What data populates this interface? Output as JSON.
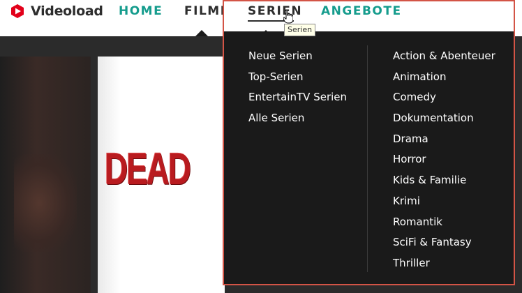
{
  "brand": {
    "name": "Videoload",
    "logo_color": "#e2001a"
  },
  "nav": {
    "items": [
      {
        "label": "HOME",
        "color": "#159c8d"
      },
      {
        "label": "FILME",
        "color": "#2d2d2d"
      },
      {
        "label": "SERIEN",
        "color": "#2d2d2d",
        "active": true
      },
      {
        "label": "ANGEBOTE",
        "color": "#159c8d"
      }
    ]
  },
  "tooltip": "Serien",
  "poster": {
    "title": "DEAD"
  },
  "dropdown": {
    "left_column": [
      "Neue Serien",
      "Top-Serien",
      "EntertainTV Serien",
      "Alle Serien"
    ],
    "right_column": [
      "Action & Abenteuer",
      "Animation",
      "Comedy",
      "Dokumentation",
      "Drama",
      "Horror",
      "Kids & Familie",
      "Krimi",
      "Romantik",
      "SciFi & Fantasy",
      "Thriller"
    ]
  },
  "icons": {
    "logo": "videoload-logo-icon",
    "cursor": "hand-pointer-icon"
  },
  "colors": {
    "accent": "#159c8d",
    "highlight_border": "#d35446",
    "menu_bg": "#1a1a1a"
  }
}
